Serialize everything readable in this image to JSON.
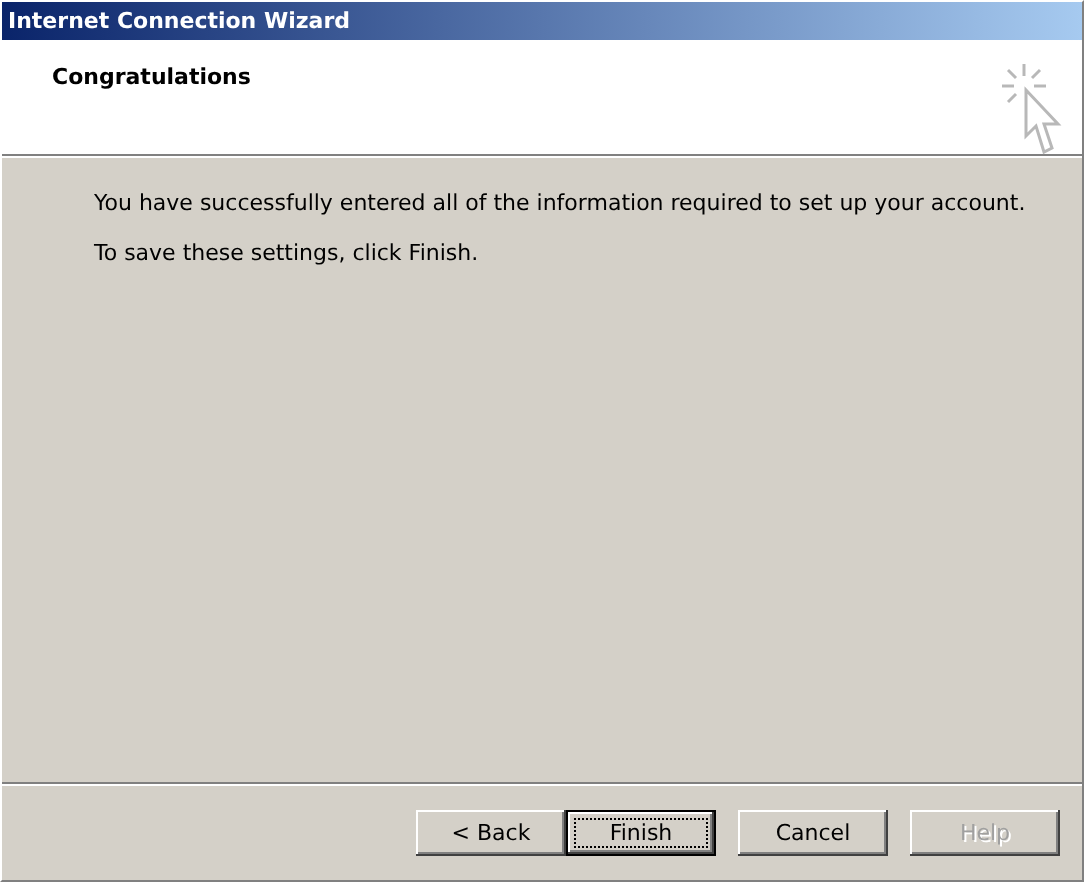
{
  "window": {
    "title": "Internet Connection Wizard"
  },
  "header": {
    "title": "Congratulations"
  },
  "body": [
    "You have successfully entered all of the information required to set up your account.",
    "To save these settings, click Finish."
  ],
  "buttons": [
    {
      "label": "< Back",
      "default": false,
      "disabled": false
    },
    {
      "label": "Finish",
      "default": true,
      "disabled": false
    },
    {
      "label": "Cancel",
      "default": false,
      "disabled": false
    },
    {
      "label": "Help",
      "default": false,
      "disabled": true
    }
  ]
}
